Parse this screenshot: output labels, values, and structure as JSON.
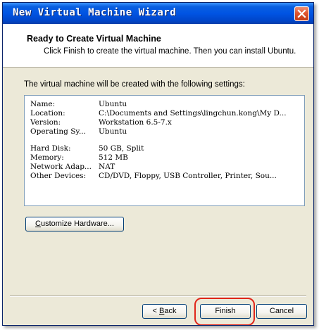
{
  "window": {
    "title": "New Virtual Machine Wizard"
  },
  "header": {
    "title": "Ready to Create Virtual Machine",
    "subtitle": "Click Finish to create the virtual machine. Then you can install Ubuntu."
  },
  "intro": "The virtual machine will be created with the following settings:",
  "settings": [
    {
      "label": "Name:",
      "value": "Ubuntu"
    },
    {
      "label": "Location:",
      "value": "C:\\Documents and Settings\\lingchun.kong\\My D..."
    },
    {
      "label": "Version:",
      "value": "Workstation 6.5-7.x"
    },
    {
      "label": "Operating Sy...",
      "value": "Ubuntu"
    },
    {
      "label": "Hard Disk:",
      "value": "50 GB, Split"
    },
    {
      "label": "Memory:",
      "value": "512 MB"
    },
    {
      "label": "Network Adap...",
      "value": "NAT"
    },
    {
      "label": "Other Devices:",
      "value": "CD/DVD, Floppy, USB Controller, Printer, Sou..."
    }
  ],
  "buttons": {
    "customize_mnemonic": "C",
    "customize_rest": "ustomize Hardware...",
    "back_prefix": "< ",
    "back_mnemonic": "B",
    "back_rest": "ack",
    "finish": "Finish",
    "cancel": "Cancel"
  },
  "icons": {
    "close": "close-x-icon"
  },
  "colors": {
    "titlebar": "#0054e3",
    "close_button": "#e0552f",
    "highlight": "#e0261b",
    "dialog_bg": "#ece9d8"
  }
}
